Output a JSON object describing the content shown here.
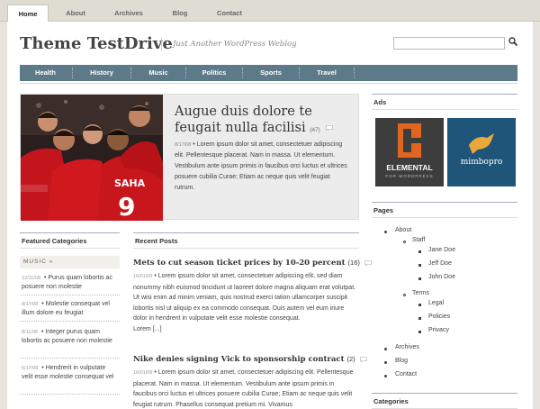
{
  "top_nav": [
    "Home",
    "About",
    "Archives",
    "Blog",
    "Contact"
  ],
  "site": {
    "title": "Theme TestDrive",
    "tagline": "Just Another WordPress Weblog"
  },
  "search": {
    "placeholder": ""
  },
  "main_nav": [
    "Health",
    "History",
    "Music",
    "Politics",
    "Sports",
    "Travel"
  ],
  "feature": {
    "title": "Augue duis dolore te feugait nulla facilisi",
    "comment_count": "(47)",
    "date": "8/17/08",
    "excerpt": "Lorem ipsum dolor sit amet, consectetuer adipiscing elit. Pellentesque placerat. Nam in massa. Ut elementum. Vestibulum ante ipsum primis in faucibus orci luctus et ultrices posuere cubilia Curae; Etiam ac neque quis velit feugiat rutrum."
  },
  "featured_categories": {
    "title": "Featured Categories",
    "label": "MUSIC »",
    "items": [
      {
        "date": "12/11/08",
        "text": "Purus quam lobortis ac posuere non molestie"
      },
      {
        "date": "8/17/08",
        "text": "Molestie consequat vel illum dolore eu feugiat"
      },
      {
        "date": "8/11/08",
        "text": "Integer purus quam lobortis ac posuere non molestie"
      },
      {
        "date": "5/17/08",
        "text": "Hendrerit in vulputate velit esse molestie consequat vel"
      }
    ]
  },
  "recent_posts": {
    "title": "Recent Posts",
    "posts": [
      {
        "title": "Mets to cut season ticket prices by 10-20 percent",
        "count": "(16)",
        "date": "10/01/09",
        "body": "Lorem ipsum dolor sit amet, consectetuer adipiscing elit, sed diam nonummy nibh euismod tincidunt ut laoreet dolore magna aliquam erat volutpat. Ut wisi enim ad minim veniam, quis nostrud exerci tation ullamcorper suscipit lobortis nisl ut aliquip ex ea commodo consequat. Duis autem vel eum iriure dolor in hendrerit in vulputate velit esse molestie consequat.",
        "more": "Lorem [...]"
      },
      {
        "title": "Nike denies signing Vick to sponsorship contract",
        "count": "(2)",
        "date": "10/01/09",
        "body": "Lorem ipsum dolor sit amet, consectetuer adipiscing elit. Pellentesque placerat. Nam in massa. Ut elementum. Vestibulum ante ipsum primis in faucibus orci luctus et ultrices posuere cubilia Curae; Etiam ac neque quis velit feugiat rutrum. Phasellus consequat pretium mi. Vivamus"
      }
    ]
  },
  "ads": {
    "title": "Ads",
    "elemental": {
      "name": "ELEMENTAL",
      "sub": "FOR WORDPRESS"
    },
    "mimbo": {
      "name": "mimbopro"
    }
  },
  "pages": {
    "title": "Pages",
    "about": "About",
    "staff": "Staff",
    "staff_members": [
      "Jane Doe",
      "Jeff Doe",
      "John Doe"
    ],
    "terms": "Terms",
    "terms_items": [
      "Legal",
      "Policies",
      "Privacy"
    ],
    "archives": "Archives",
    "blog": "Blog",
    "contact": "Contact"
  },
  "categories_title": "Categories",
  "colors": {
    "nav": "#5d7a89",
    "background": "#e6e4dc"
  }
}
